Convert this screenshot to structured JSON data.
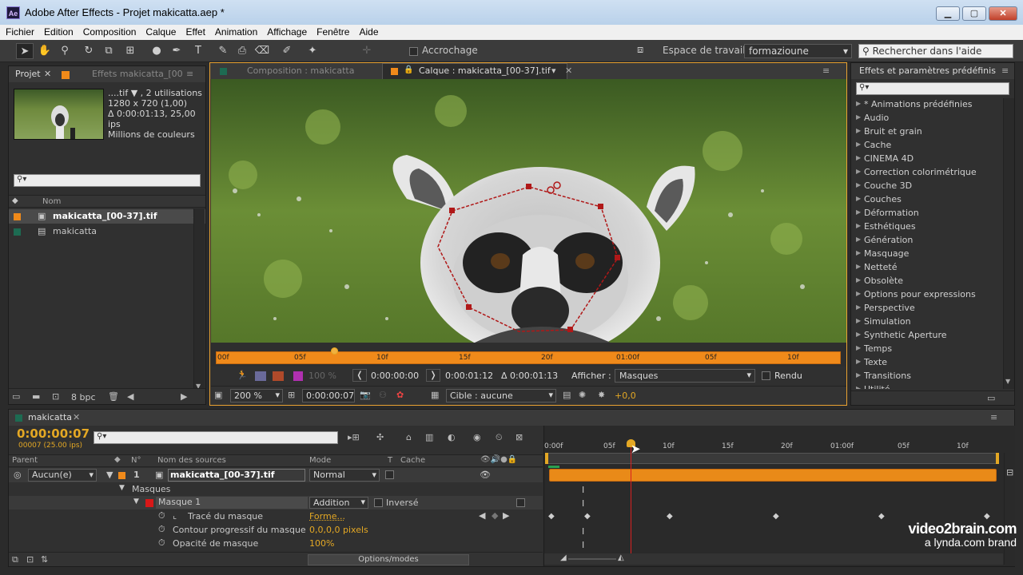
{
  "window": {
    "title": "Adobe After Effects - Projet makicatta.aep *",
    "app_logo": "Ae"
  },
  "menu": [
    "Fichier",
    "Edition",
    "Composition",
    "Calque",
    "Effet",
    "Animation",
    "Affichage",
    "Fenêtre",
    "Aide"
  ],
  "toolbar": {
    "snap_label": "Accrochage",
    "workspace_label": "Espace de travail :",
    "workspace_value": "formazioune",
    "search_help": "Rechercher dans l'aide"
  },
  "project_panel": {
    "tab_project": "Projet",
    "tab_effects": "Effets makicatta_[00",
    "thumb_name": "....tif ▼ , 2 utilisations",
    "thumb_size": "1280 x 720 (1,00)",
    "thumb_duration": "Δ 0:00:01:13, 25,00 ips",
    "thumb_colors": "Millions de couleurs",
    "col_name": "Nom",
    "items": [
      {
        "name": "makicatta_[00-37].tif",
        "color": "#f08a1a"
      },
      {
        "name": "makicatta",
        "color": "#1d6b52"
      }
    ],
    "bpc": "8 bpc"
  },
  "viewer": {
    "tab_comp": "Composition : makicatta",
    "tab_layer": "Calque : makicatta_[00-37].tif",
    "ruler_ticks": [
      "00f",
      "05f",
      "10f",
      "15f",
      "20f",
      "01:00f",
      "05f",
      "10f"
    ],
    "time_in": "0:00:00:00",
    "time_out": "0:00:01:12",
    "duration": "Δ 0:00:01:13",
    "show_label": "Afficher :",
    "show_value": "Masques",
    "render_label": "Rendu",
    "zoom": "200 %",
    "current_time": "0:00:00:07",
    "target": "Cible : aucune",
    "exposure": "+0,0",
    "percent": "100 %"
  },
  "effects_panel": {
    "title": "Effets et paramètres prédéfinis",
    "items": [
      "* Animations prédéfinies",
      "Audio",
      "Bruit et grain",
      "Cache",
      "CINEMA 4D",
      "Correction colorimétrique",
      "Couche 3D",
      "Couches",
      "Déformation",
      "Esthétiques",
      "Génération",
      "Masquage",
      "Netteté",
      "Obsolète",
      "Options pour expressions",
      "Perspective",
      "Simulation",
      "Synthetic Aperture",
      "Temps",
      "Texte",
      "Transitions",
      "Utilité"
    ]
  },
  "timeline": {
    "tab": "makicatta",
    "timecode": "0:00:00:07",
    "frames": "00007 (25.00 ips)",
    "headers": {
      "parent": "Parent",
      "num": "N°",
      "source": "Nom des sources",
      "mode": "Mode",
      "t": "T",
      "cache": "Cache"
    },
    "ruler_ticks": [
      "0:00f",
      "05f",
      "10f",
      "15f",
      "20f",
      "01:00f",
      "05f",
      "10f"
    ],
    "layer": {
      "parent": "Aucun(e)",
      "num": "1",
      "name": "makicatta_[00-37].tif",
      "mode": "Normal"
    },
    "masks_group": "Masques",
    "mask": {
      "name": "Masque 1",
      "mode": "Addition",
      "inverted": "Inversé"
    },
    "props": [
      {
        "name": "Tracé du masque",
        "value": "Forme..."
      },
      {
        "name": "Contour progressif du masque",
        "value": "0,0,0,0 pixels"
      },
      {
        "name": "Opacité de masque",
        "value": "100%"
      }
    ],
    "options_button": "Options/modes"
  },
  "watermark": {
    "line1": "video2brain.com",
    "line2": "a lynda.com brand"
  }
}
